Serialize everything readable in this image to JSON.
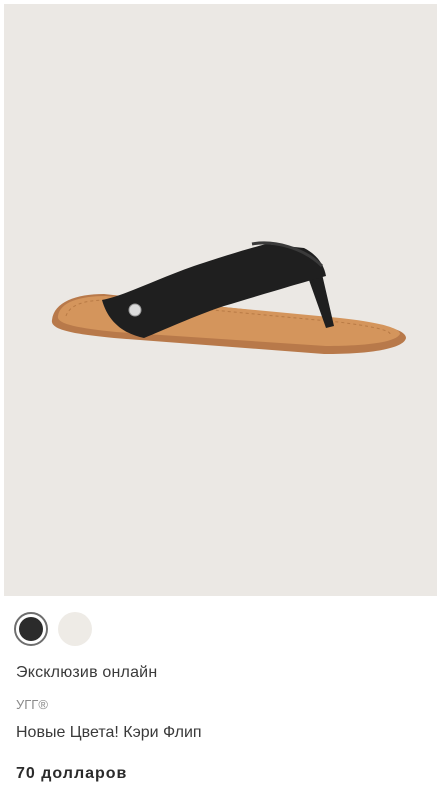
{
  "product": {
    "image_alt": "product-photo",
    "swatches": [
      {
        "name": "black",
        "color": "#2b2b2b",
        "selected": true
      },
      {
        "name": "cream",
        "color": "#eeebe6",
        "selected": false
      }
    ],
    "badge": "Эксклюзив онлайн",
    "brand": "УГГ®",
    "name": "Новые Цвета! Кэри Флип",
    "price": "70 долларов"
  },
  "colors": {
    "image_background": "#ebe8e4",
    "strap": "#1f1f1f",
    "sole": "#c8884e"
  }
}
